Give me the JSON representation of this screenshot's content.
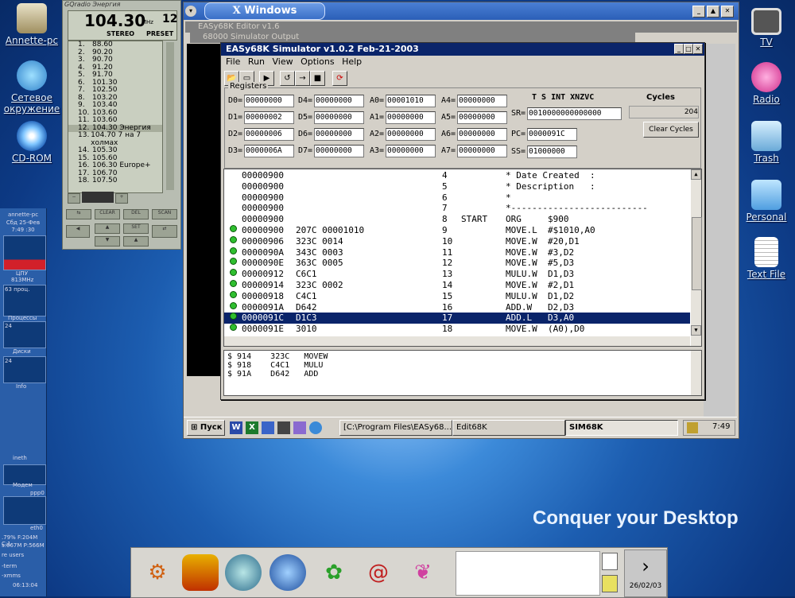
{
  "desktop_left": [
    {
      "label": "Annette-pc",
      "icon": "home-icon"
    },
    {
      "label": "Сетевое окружение",
      "icon": "network-icon"
    },
    {
      "label": "CD-ROM",
      "icon": "cdrom-icon"
    }
  ],
  "desktop_right": [
    {
      "label": "TV",
      "icon": "tv-icon"
    },
    {
      "label": "Radio",
      "icon": "radio-icon"
    },
    {
      "label": "Trash",
      "icon": "trash-icon"
    },
    {
      "label": "Personal",
      "icon": "folder-icon"
    },
    {
      "label": "Text File",
      "icon": "text-file-icon"
    }
  ],
  "slogan": "Conquer your Desktop",
  "radio": {
    "title": "GQradio Энергия",
    "freq": "104.30",
    "unit": "MHz",
    "preset": "12",
    "stereo": "STEREO",
    "preset_label": "PRESET",
    "stations": [
      {
        "n": "1.",
        "f": "88.60"
      },
      {
        "n": "2.",
        "f": "90.20"
      },
      {
        "n": "3.",
        "f": "90.70"
      },
      {
        "n": "4.",
        "f": "91.20"
      },
      {
        "n": "5.",
        "f": "91.70"
      },
      {
        "n": "6.",
        "f": "101.30"
      },
      {
        "n": "7.",
        "f": "102.50"
      },
      {
        "n": "8.",
        "f": "103.20"
      },
      {
        "n": "9.",
        "f": "103.40"
      },
      {
        "n": "10.",
        "f": "103.60"
      },
      {
        "n": "11.",
        "f": "103.60"
      },
      {
        "n": "12.",
        "f": "104.30 Энергия"
      },
      {
        "n": "13.",
        "f": "104.70 7 на 7 холмах"
      },
      {
        "n": "14.",
        "f": "105.30"
      },
      {
        "n": "15.",
        "f": "105.60"
      },
      {
        "n": "16.",
        "f": "106.30 Europe+"
      },
      {
        "n": "17.",
        "f": "106.70"
      },
      {
        "n": "18.",
        "f": "107.50"
      }
    ],
    "buttons": [
      "CLEAR",
      "DEL",
      "SCAN",
      "SET"
    ]
  },
  "monitor": {
    "host": "annette-pc",
    "date": "Сбд 25-Фев",
    "time": "7:49 :30",
    "cpu_label": "ЦПУ",
    "cpu_val": "813MHz",
    "mem": "63 проц.",
    "procs_label": "Процессы",
    "disk_label": "Диски",
    "info": "Info",
    "scale24": "24",
    "eth_label": "ineth",
    "modem_label": "Модем",
    "ppp": "ppp0",
    "eth0": "eth0",
    "stats": ".79% F:204M C:1",
    "stats2": "s:667M P:566M",
    "users": "re users",
    "row1": "-term",
    "row2": "-xmms",
    "clock": "06:13:04"
  },
  "window": {
    "title": "Windows",
    "editor_title": "EASy68K Editor v1.6",
    "output_title": "68000 Simulator Output"
  },
  "sim": {
    "title": "EASy68K Simulator v1.0.2  Feb-21-2003",
    "menu": [
      "File",
      "Run",
      "View",
      "Options",
      "Help"
    ],
    "registers_label": "Registers",
    "regs_col1": [
      {
        "n": "D0=",
        "v": "00000000"
      },
      {
        "n": "D1=",
        "v": "00000002"
      },
      {
        "n": "D2=",
        "v": "00000006"
      },
      {
        "n": "D3=",
        "v": "0000006A"
      }
    ],
    "regs_col2": [
      {
        "n": "D4=",
        "v": "00000000"
      },
      {
        "n": "D5=",
        "v": "00000000"
      },
      {
        "n": "D6=",
        "v": "00000000"
      },
      {
        "n": "D7=",
        "v": "00000000"
      }
    ],
    "regs_col3": [
      {
        "n": "A0=",
        "v": "00001010"
      },
      {
        "n": "A1=",
        "v": "00000000"
      },
      {
        "n": "A2=",
        "v": "00000000"
      },
      {
        "n": "A3=",
        "v": "00000000"
      }
    ],
    "regs_col4": [
      {
        "n": "A4=",
        "v": "00000000"
      },
      {
        "n": "A5=",
        "v": "00000000"
      },
      {
        "n": "A6=",
        "v": "00000000"
      },
      {
        "n": "A7=",
        "v": "00000000"
      }
    ],
    "sr_header": "T S  INT   XNZVC",
    "sr": {
      "n": "SR=",
      "v": "0010000000000000"
    },
    "pc": {
      "n": "PC=",
      "v": "0000091C"
    },
    "ss": {
      "n": "SS=",
      "v": "01000000"
    },
    "cycles_label": "Cycles",
    "cycles": "204",
    "clear_cycles": "Clear Cycles",
    "source": [
      {
        "addr": "00000900",
        "code": "",
        "ln": "4",
        "lbl": "",
        "text": "* Date Created  :",
        "bp": false,
        "sel": false
      },
      {
        "addr": "00000900",
        "code": "",
        "ln": "5",
        "lbl": "",
        "text": "* Description   :",
        "bp": false,
        "sel": false
      },
      {
        "addr": "00000900",
        "code": "",
        "ln": "6",
        "lbl": "",
        "text": "*",
        "bp": false,
        "sel": false
      },
      {
        "addr": "00000900",
        "code": "",
        "ln": "7",
        "lbl": "",
        "text": "*--------------------------",
        "bp": false,
        "sel": false
      },
      {
        "addr": "00000900",
        "code": "",
        "ln": "8",
        "lbl": "START",
        "text": "ORG     $900",
        "bp": false,
        "sel": false
      },
      {
        "addr": "00000900",
        "code": "207C 00001010",
        "ln": "9",
        "lbl": "",
        "text": "MOVE.L  #$1010,A0",
        "bp": true,
        "sel": false
      },
      {
        "addr": "00000906",
        "code": "323C 0014",
        "ln": "10",
        "lbl": "",
        "text": "MOVE.W  #20,D1",
        "bp": true,
        "sel": false
      },
      {
        "addr": "0000090A",
        "code": "343C 0003",
        "ln": "11",
        "lbl": "",
        "text": "MOVE.W  #3,D2",
        "bp": true,
        "sel": false
      },
      {
        "addr": "0000090E",
        "code": "363C 0005",
        "ln": "12",
        "lbl": "",
        "text": "MOVE.W  #5,D3",
        "bp": true,
        "sel": false
      },
      {
        "addr": "00000912",
        "code": "C6C1",
        "ln": "13",
        "lbl": "",
        "text": "MULU.W  D1,D3",
        "bp": true,
        "sel": false
      },
      {
        "addr": "00000914",
        "code": "323C 0002",
        "ln": "14",
        "lbl": "",
        "text": "MOVE.W  #2,D1",
        "bp": true,
        "sel": false
      },
      {
        "addr": "00000918",
        "code": "C4C1",
        "ln": "15",
        "lbl": "",
        "text": "MULU.W  D1,D2",
        "bp": true,
        "sel": false
      },
      {
        "addr": "0000091A",
        "code": "D642",
        "ln": "16",
        "lbl": "",
        "text": "ADD.W   D2,D3",
        "bp": true,
        "sel": false
      },
      {
        "addr": "0000091C",
        "code": "D1C3",
        "ln": "17",
        "lbl": "",
        "text": "ADD.L   D3,A0",
        "bp": true,
        "sel": true
      },
      {
        "addr": "0000091E",
        "code": "3010",
        "ln": "18",
        "lbl": "",
        "text": "MOVE.W  (A0),D0",
        "bp": true,
        "sel": false
      }
    ],
    "output": [
      "$ 914    323C   MOVEW",
      "$ 918    C4C1   MULU",
      "$ 91A    D642   ADD"
    ]
  },
  "taskbar": {
    "start": "Пуск",
    "tasks": [
      "[C:\\Program Files\\EASy68...",
      "Edit68K",
      "SIM68K"
    ],
    "clock": "7:49"
  },
  "dock": {
    "date": "26/02/03"
  }
}
